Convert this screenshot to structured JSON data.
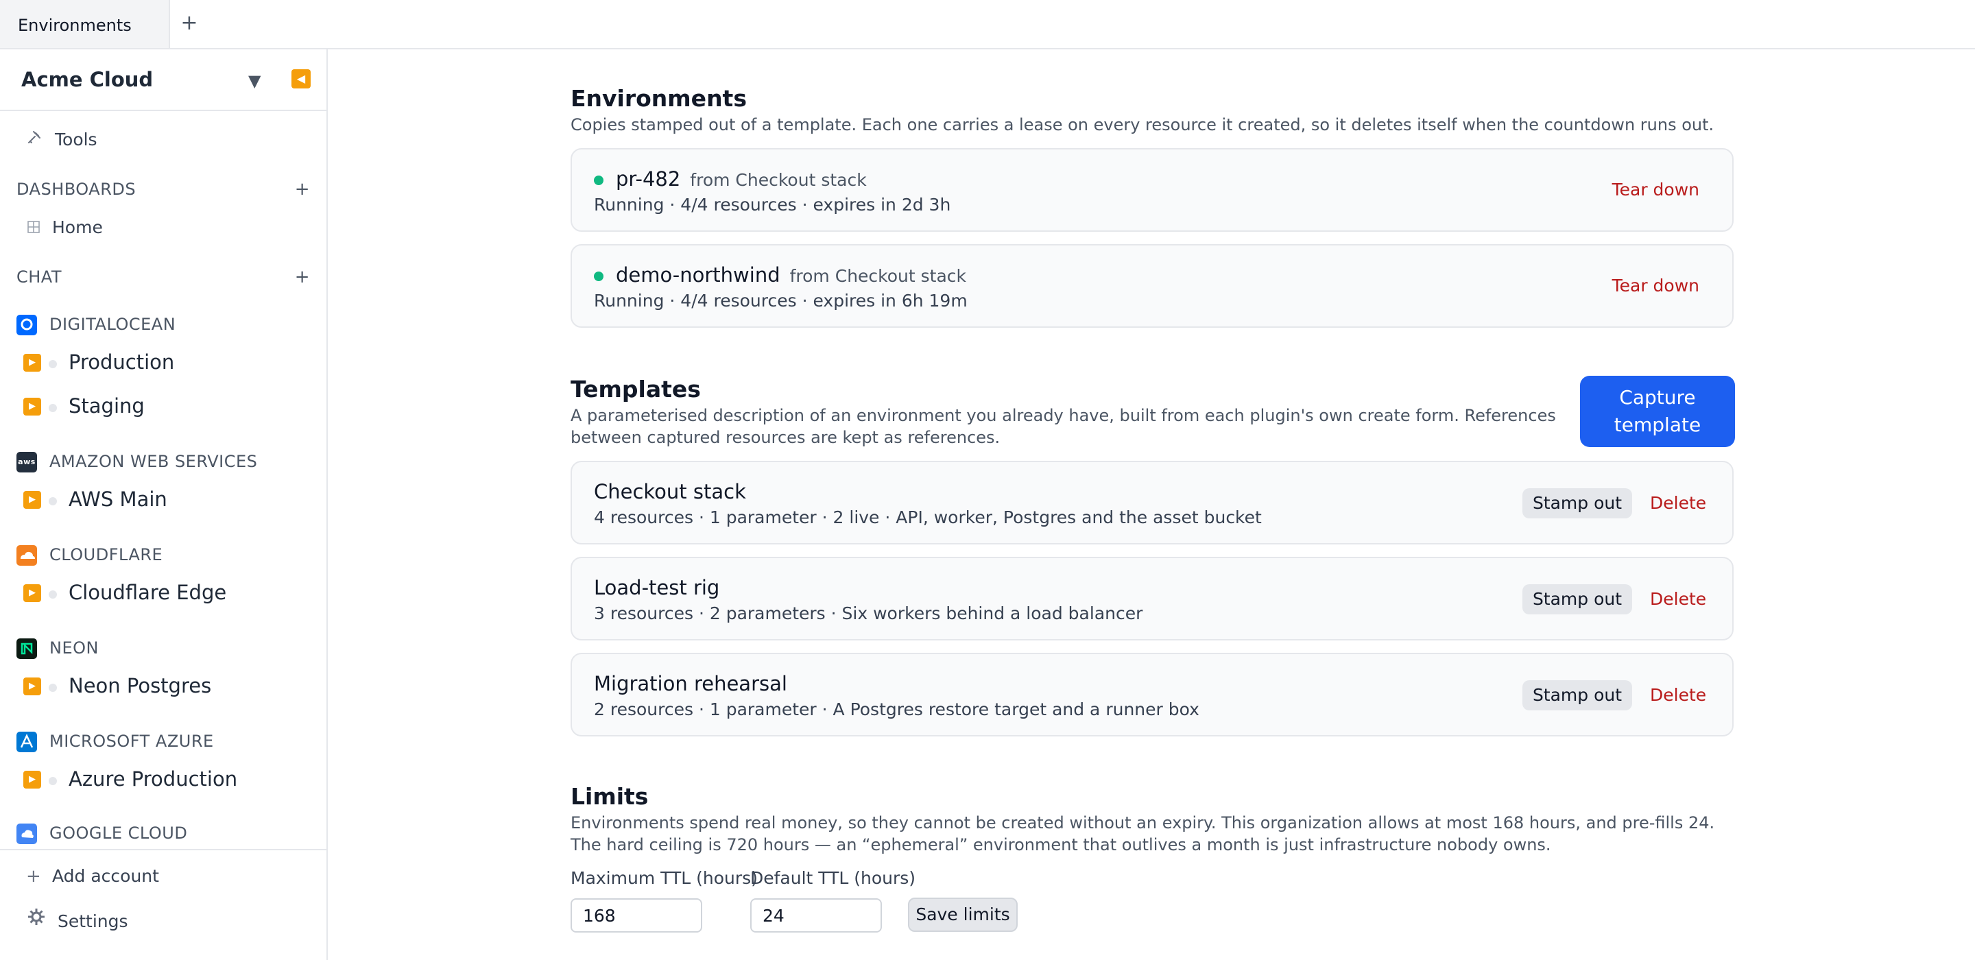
{
  "tabs": {
    "active_label": "Environments",
    "add_label": "+"
  },
  "sidebar": {
    "org_name": "Acme Cloud",
    "org_caret": "▼",
    "collapse_glyph": "◀",
    "tools_label": "Tools",
    "dashboards": {
      "heading": "DASHBOARDS",
      "add": "+",
      "home_label": "Home"
    },
    "chat": {
      "heading": "CHAT",
      "add": "+"
    },
    "providers": [
      {
        "name": "DIGITALOCEAN",
        "color": "#0069ff",
        "accounts": [
          "Production",
          "Staging"
        ]
      },
      {
        "name": "AMAZON WEB SERVICES",
        "color": "#232f3e",
        "accounts": [
          "AWS Main"
        ]
      },
      {
        "name": "CLOUDFLARE",
        "color": "#f38020",
        "accounts": [
          "Cloudflare Edge"
        ]
      },
      {
        "name": "NEON",
        "color": "#0b1a12",
        "accounts": [
          "Neon Postgres"
        ]
      },
      {
        "name": "MICROSOFT AZURE",
        "color": "#0078d4",
        "accounts": [
          "Azure Production"
        ]
      },
      {
        "name": "GOOGLE CLOUD",
        "color": "#4285f4",
        "accounts": []
      }
    ],
    "footer": {
      "add_account": "Add account",
      "settings": "Settings"
    }
  },
  "environments": {
    "title": "Environments",
    "description": "Copies stamped out of a template. Each one carries a lease on every resource it created, so it deletes itself when the countdown runs out.",
    "items": [
      {
        "name": "pr-482",
        "from": "from Checkout stack",
        "status": "Running · 4/4 resources · expires in 2d 3h",
        "action": "Tear down",
        "status_color": "#10b981"
      },
      {
        "name": "demo-northwind",
        "from": "from Checkout stack",
        "status": "Running · 4/4 resources · expires in 6h 19m",
        "action": "Tear down",
        "status_color": "#10b981"
      }
    ]
  },
  "templates": {
    "title": "Templates",
    "description": "A parameterised description of an environment you already have, built from each plugin's own create form. References between captured resources are kept as references.",
    "capture_button": "Capture template",
    "items": [
      {
        "name": "Checkout stack",
        "details": "4 resources · 1 parameter · 2 live · API, worker, Postgres and the asset bucket",
        "stamp": "Stamp out",
        "delete": "Delete"
      },
      {
        "name": "Load-test rig",
        "details": "3 resources · 2 parameters · Six workers behind a load balancer",
        "stamp": "Stamp out",
        "delete": "Delete"
      },
      {
        "name": "Migration rehearsal",
        "details": "2 resources · 1 parameter · A Postgres restore target and a runner box",
        "stamp": "Stamp out",
        "delete": "Delete"
      }
    ]
  },
  "limits": {
    "title": "Limits",
    "description": "Environments spend real money, so they cannot be created without an expiry. This organization allows at most 168 hours, and pre-fills 24. The hard ceiling is 720 hours — an “ephemeral” environment that outlives a month is just infrastructure nobody owns.",
    "max_ttl_label": "Maximum TTL (hours)",
    "max_ttl_value": "168",
    "default_ttl_label": "Default TTL (hours)",
    "default_ttl_value": "24",
    "save_button": "Save limits"
  },
  "accent_color": "#1d5ff0",
  "danger_color": "#b91c1c"
}
